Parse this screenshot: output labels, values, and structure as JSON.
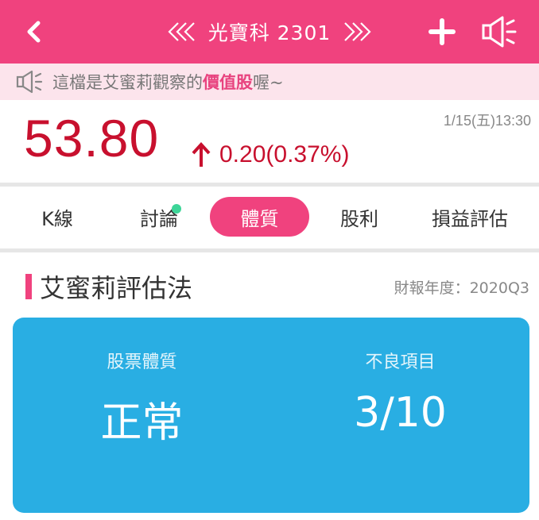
{
  "header": {
    "title": "光寶科 2301",
    "bg_color": "#f0427e"
  },
  "notice": {
    "prefix": "這檔是艾蜜莉觀察的",
    "highlight": "價值股",
    "suffix": "喔~"
  },
  "quote": {
    "price": "53.80",
    "change": "0.20(0.37%)",
    "direction": "up",
    "time": "1/15(五)13:30",
    "color": "#c8102e"
  },
  "tabs": [
    {
      "label": "K線",
      "active": false,
      "badge": false
    },
    {
      "label": "討論",
      "active": false,
      "badge": true
    },
    {
      "label": "體質",
      "active": true,
      "badge": false
    },
    {
      "label": "股利",
      "active": false,
      "badge": false
    },
    {
      "label": "損益評估",
      "active": false,
      "badge": false
    }
  ],
  "section": {
    "title": "艾蜜莉評估法",
    "report_year": "財報年度：2020Q3"
  },
  "card": {
    "bg_color": "#29aee3",
    "health_label": "股票體質",
    "health_value": "正常",
    "bad_label": "不良項目",
    "bad_value": "3/10"
  },
  "icons": {
    "back": "chevron-left-icon",
    "prev": "double-chevron-left-icon",
    "next": "double-chevron-right-icon",
    "add": "plus-icon",
    "announce": "megaphone-icon"
  }
}
